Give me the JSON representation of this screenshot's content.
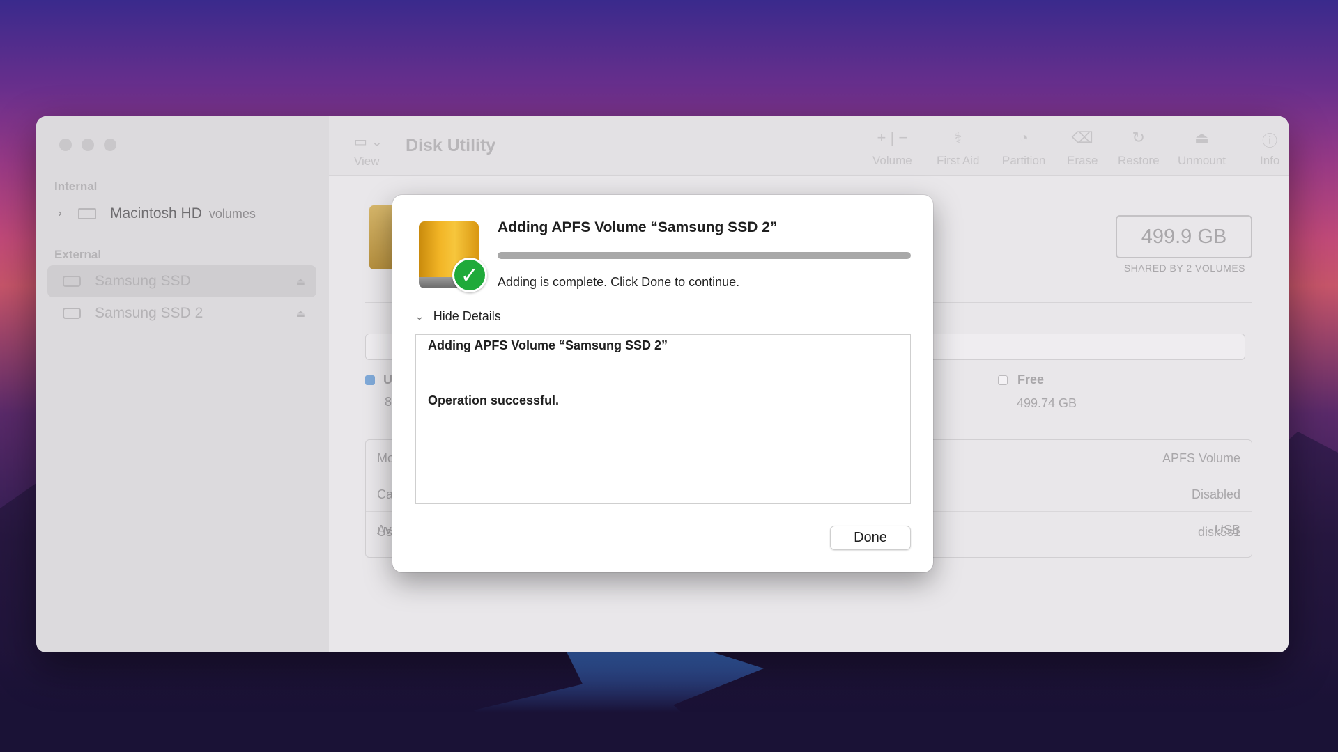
{
  "window": {
    "title": "Disk Utility",
    "view_label": "View"
  },
  "toolbar": {
    "volume_label": "Volume",
    "first_aid_label": "First Aid",
    "partition_label": "Partition",
    "erase_label": "Erase",
    "restore_label": "Restore",
    "unmount_label": "Unmount",
    "info_label": "Info"
  },
  "sidebar": {
    "internal_label": "Internal",
    "external_label": "External",
    "internal_items": [
      {
        "name": "Macintosh HD",
        "sub": "volumes"
      }
    ],
    "external_items": [
      {
        "name": "Samsung SSD"
      },
      {
        "name": "Samsung SSD 2"
      }
    ]
  },
  "main": {
    "capacity": "499.9 GB",
    "capacity_sub": "SHARED BY 2 VOLUMES",
    "used_label": "U",
    "used_value": "8",
    "free_label": "Free",
    "free_value": "499.74 GB",
    "info_rows": [
      {
        "key": "Mo",
        "value": "APFS Volume"
      },
      {
        "key": "Ca",
        "value": "Disabled"
      },
      {
        "key": "Av",
        "value": "USB"
      },
      {
        "key": "Us",
        "value": "disk5s1"
      }
    ]
  },
  "dialog": {
    "title": "Adding APFS Volume “Samsung SSD 2”",
    "progress_percent": 100,
    "status": "Adding is complete. Click Done to continue.",
    "hide_details_label": "Hide Details",
    "details_line1": "Adding APFS Volume “Samsung SSD 2”",
    "details_line2": "Operation successful.",
    "done_label": "Done"
  },
  "icons": {
    "view": "sidebar-icon",
    "volume": "plus-minus-icon",
    "first_aid": "stethoscope-icon",
    "partition": "pie-icon",
    "erase": "erase-icon",
    "restore": "restore-icon",
    "unmount": "unmount-icon",
    "info": "info-icon",
    "drive": "external-drive-icon",
    "check": "checkmark-icon"
  },
  "colors": {
    "drive_gold": "#f2b526",
    "success_green": "#1faa3a"
  }
}
